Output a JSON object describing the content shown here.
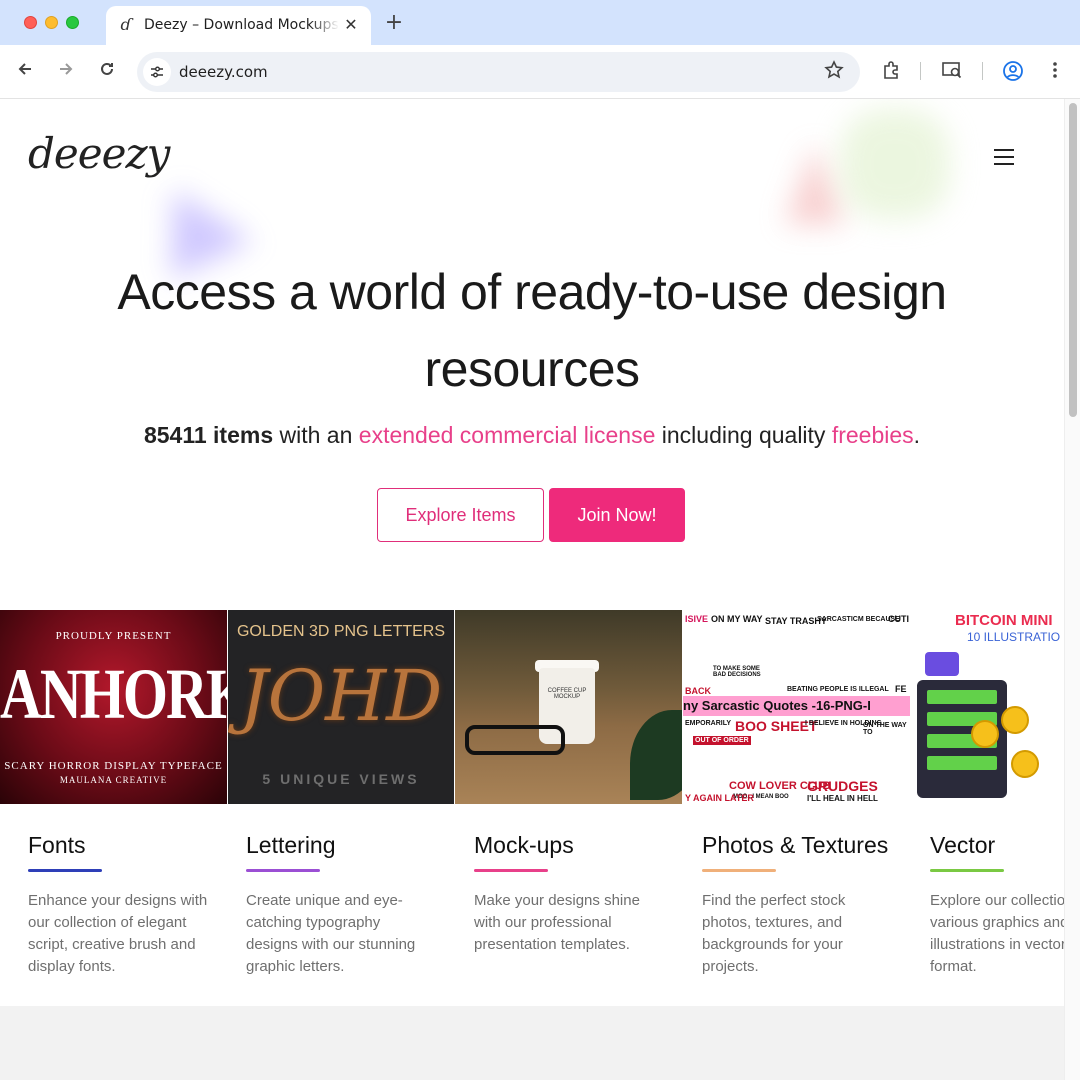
{
  "browser": {
    "tab_title": "Deezy – Download Mockups, Fonts & Graphics",
    "tab_favicon": "deeezy-favicon",
    "tab_close": "✕",
    "new_tab": "+",
    "url": "deeezy.com",
    "icons": {
      "back": "arrow-left-icon",
      "forward": "arrow-right-icon",
      "reload": "reload-icon",
      "site_info": "tune-icon",
      "bookmark": "star-icon",
      "extensions": "puzzle-icon",
      "cast": "cast-search-icon",
      "profile": "profile-icon",
      "menu": "kebab-menu-icon"
    }
  },
  "site": {
    "logo": "deeezy",
    "hero": {
      "title": "Access a world of ready-to-use design resources",
      "count": "85411 items",
      "text_1": " with an ",
      "license_link": "extended commercial license",
      "text_2": " including quality ",
      "freebies_link": "freebies",
      "text_3": "."
    },
    "buttons": {
      "explore": "Explore Items",
      "join": "Join Now!"
    },
    "accent_color": "#ee2a7b",
    "categories": [
      {
        "title": "Fonts",
        "description": "Enhance your designs with our collection of elegant script, creative brush and display fonts.",
        "underline_color": "#2e3fb8"
      },
      {
        "title": "Lettering",
        "description": "Create unique and eye-catching typography designs with our stunning graphic letters.",
        "underline_color": "#9b4fd4"
      },
      {
        "title": "Mock-ups",
        "description": "Make your designs shine with our professional presentation templates.",
        "underline_color": "#e8408a"
      },
      {
        "title": "Photos & Textures",
        "description": "Find the perfect stock photos, textures, and backgrounds for your projects.",
        "underline_color": "#f0b07a"
      },
      {
        "title": "Vector",
        "description": "Explore our collection of various graphics and illustrations in vector format.",
        "underline_color": "#7ac943"
      }
    ],
    "previews": {
      "fonts": {
        "top": "PROUDLY PRESENT",
        "big": "ANHORK",
        "sub": "SCARY HORROR DISPLAY TYPEFACE",
        "credit": "MAULANA CREATIVE"
      },
      "lettering": {
        "head": "GOLDEN 3D PNG LETTERS",
        "big": "JOHD",
        "foot": "5 UNIQUE VIEWS"
      },
      "mockups": {
        "cup_text": "COFFEE CUP MOCKUP"
      },
      "photos": {
        "banner": "ny Sarcastic Quotes -16-PNG-I",
        "cells": [
          "ISIVE",
          "ON MY WAY",
          "STAY TRASHY",
          "SARCASTICM BECAUSE",
          "CUTI",
          "TO MAKE SOME BAD DECISIONS",
          "BACK",
          "BEATING PEOPLE IS ILLEGAL",
          "FE",
          "EMPORARILY",
          "OUT OF ORDER",
          "BOO SHEET",
          "I BELIEVE IN HOLDING",
          "ON THE WAY TO",
          "COW LOVER CLUB",
          "MOO...I MEAN BOO",
          "GRUDGES",
          "I'LL HEAL IN HELL",
          "Y AGAIN LATER"
        ]
      },
      "vector": {
        "title": "BITCOIN MINI",
        "sub": "10 ILLUSTRATIO"
      }
    }
  }
}
